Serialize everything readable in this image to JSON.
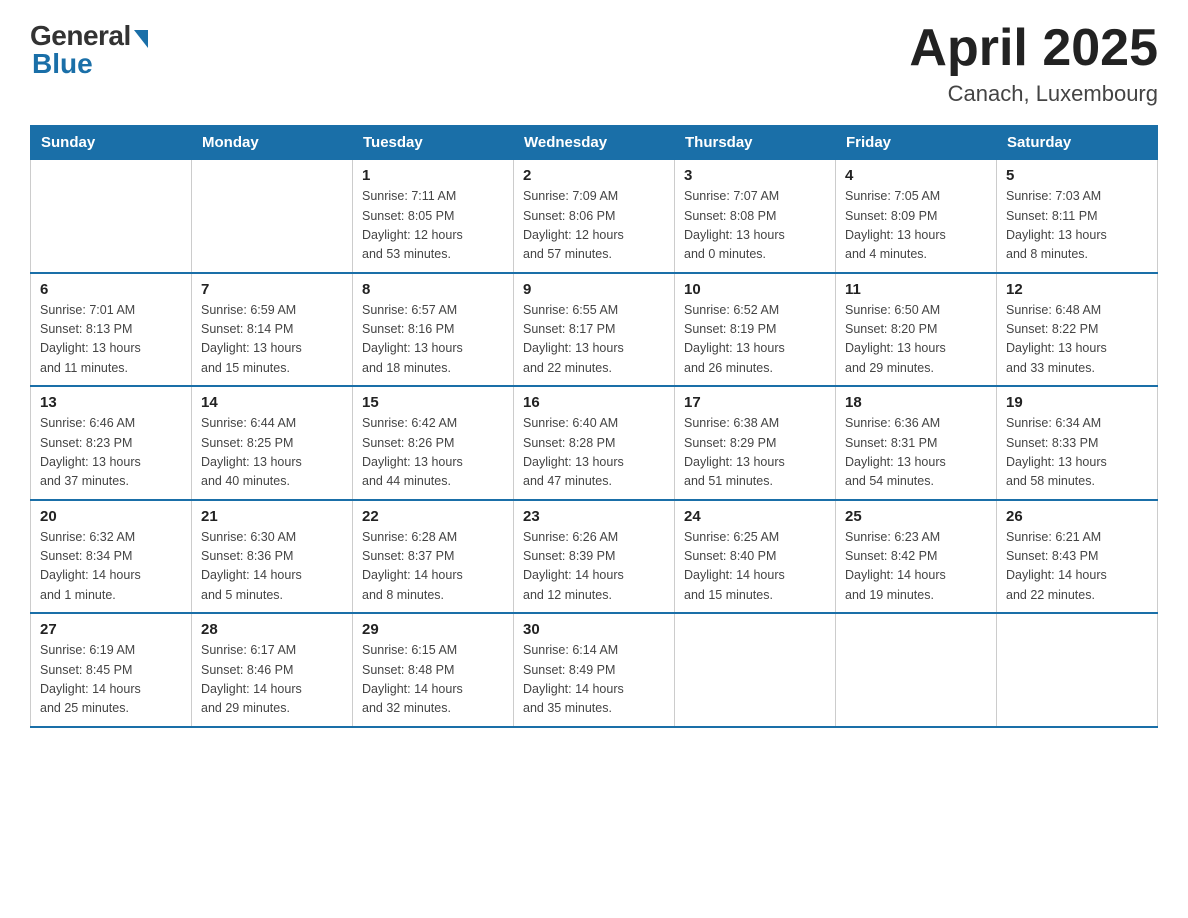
{
  "header": {
    "logo": {
      "general": "General",
      "blue": "Blue"
    },
    "title": "April 2025",
    "location": "Canach, Luxembourg"
  },
  "days_of_week": [
    "Sunday",
    "Monday",
    "Tuesday",
    "Wednesday",
    "Thursday",
    "Friday",
    "Saturday"
  ],
  "weeks": [
    [
      {
        "day": "",
        "info": ""
      },
      {
        "day": "",
        "info": ""
      },
      {
        "day": "1",
        "info": "Sunrise: 7:11 AM\nSunset: 8:05 PM\nDaylight: 12 hours\nand 53 minutes."
      },
      {
        "day": "2",
        "info": "Sunrise: 7:09 AM\nSunset: 8:06 PM\nDaylight: 12 hours\nand 57 minutes."
      },
      {
        "day": "3",
        "info": "Sunrise: 7:07 AM\nSunset: 8:08 PM\nDaylight: 13 hours\nand 0 minutes."
      },
      {
        "day": "4",
        "info": "Sunrise: 7:05 AM\nSunset: 8:09 PM\nDaylight: 13 hours\nand 4 minutes."
      },
      {
        "day": "5",
        "info": "Sunrise: 7:03 AM\nSunset: 8:11 PM\nDaylight: 13 hours\nand 8 minutes."
      }
    ],
    [
      {
        "day": "6",
        "info": "Sunrise: 7:01 AM\nSunset: 8:13 PM\nDaylight: 13 hours\nand 11 minutes."
      },
      {
        "day": "7",
        "info": "Sunrise: 6:59 AM\nSunset: 8:14 PM\nDaylight: 13 hours\nand 15 minutes."
      },
      {
        "day": "8",
        "info": "Sunrise: 6:57 AM\nSunset: 8:16 PM\nDaylight: 13 hours\nand 18 minutes."
      },
      {
        "day": "9",
        "info": "Sunrise: 6:55 AM\nSunset: 8:17 PM\nDaylight: 13 hours\nand 22 minutes."
      },
      {
        "day": "10",
        "info": "Sunrise: 6:52 AM\nSunset: 8:19 PM\nDaylight: 13 hours\nand 26 minutes."
      },
      {
        "day": "11",
        "info": "Sunrise: 6:50 AM\nSunset: 8:20 PM\nDaylight: 13 hours\nand 29 minutes."
      },
      {
        "day": "12",
        "info": "Sunrise: 6:48 AM\nSunset: 8:22 PM\nDaylight: 13 hours\nand 33 minutes."
      }
    ],
    [
      {
        "day": "13",
        "info": "Sunrise: 6:46 AM\nSunset: 8:23 PM\nDaylight: 13 hours\nand 37 minutes."
      },
      {
        "day": "14",
        "info": "Sunrise: 6:44 AM\nSunset: 8:25 PM\nDaylight: 13 hours\nand 40 minutes."
      },
      {
        "day": "15",
        "info": "Sunrise: 6:42 AM\nSunset: 8:26 PM\nDaylight: 13 hours\nand 44 minutes."
      },
      {
        "day": "16",
        "info": "Sunrise: 6:40 AM\nSunset: 8:28 PM\nDaylight: 13 hours\nand 47 minutes."
      },
      {
        "day": "17",
        "info": "Sunrise: 6:38 AM\nSunset: 8:29 PM\nDaylight: 13 hours\nand 51 minutes."
      },
      {
        "day": "18",
        "info": "Sunrise: 6:36 AM\nSunset: 8:31 PM\nDaylight: 13 hours\nand 54 minutes."
      },
      {
        "day": "19",
        "info": "Sunrise: 6:34 AM\nSunset: 8:33 PM\nDaylight: 13 hours\nand 58 minutes."
      }
    ],
    [
      {
        "day": "20",
        "info": "Sunrise: 6:32 AM\nSunset: 8:34 PM\nDaylight: 14 hours\nand 1 minute."
      },
      {
        "day": "21",
        "info": "Sunrise: 6:30 AM\nSunset: 8:36 PM\nDaylight: 14 hours\nand 5 minutes."
      },
      {
        "day": "22",
        "info": "Sunrise: 6:28 AM\nSunset: 8:37 PM\nDaylight: 14 hours\nand 8 minutes."
      },
      {
        "day": "23",
        "info": "Sunrise: 6:26 AM\nSunset: 8:39 PM\nDaylight: 14 hours\nand 12 minutes."
      },
      {
        "day": "24",
        "info": "Sunrise: 6:25 AM\nSunset: 8:40 PM\nDaylight: 14 hours\nand 15 minutes."
      },
      {
        "day": "25",
        "info": "Sunrise: 6:23 AM\nSunset: 8:42 PM\nDaylight: 14 hours\nand 19 minutes."
      },
      {
        "day": "26",
        "info": "Sunrise: 6:21 AM\nSunset: 8:43 PM\nDaylight: 14 hours\nand 22 minutes."
      }
    ],
    [
      {
        "day": "27",
        "info": "Sunrise: 6:19 AM\nSunset: 8:45 PM\nDaylight: 14 hours\nand 25 minutes."
      },
      {
        "day": "28",
        "info": "Sunrise: 6:17 AM\nSunset: 8:46 PM\nDaylight: 14 hours\nand 29 minutes."
      },
      {
        "day": "29",
        "info": "Sunrise: 6:15 AM\nSunset: 8:48 PM\nDaylight: 14 hours\nand 32 minutes."
      },
      {
        "day": "30",
        "info": "Sunrise: 6:14 AM\nSunset: 8:49 PM\nDaylight: 14 hours\nand 35 minutes."
      },
      {
        "day": "",
        "info": ""
      },
      {
        "day": "",
        "info": ""
      },
      {
        "day": "",
        "info": ""
      }
    ]
  ]
}
